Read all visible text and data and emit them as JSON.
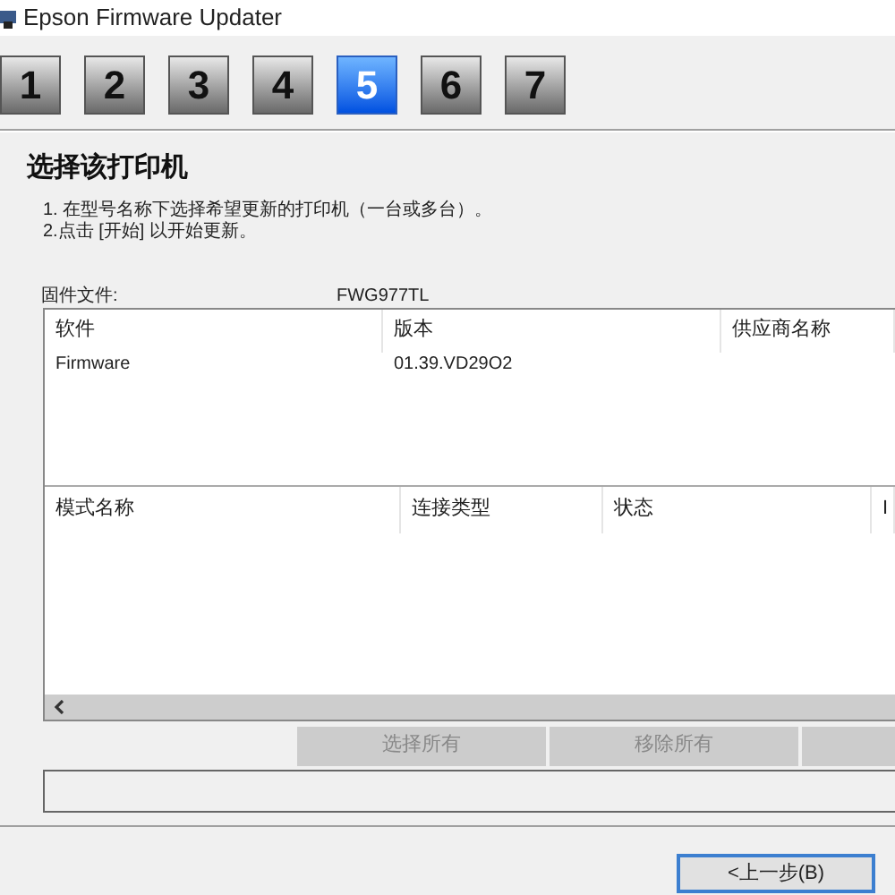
{
  "window": {
    "title": "Epson Firmware Updater"
  },
  "steps": [
    {
      "label": "1",
      "selected": false
    },
    {
      "label": "2",
      "selected": false
    },
    {
      "label": "3",
      "selected": false
    },
    {
      "label": "4",
      "selected": false
    },
    {
      "label": "5",
      "selected": true
    },
    {
      "label": "6",
      "selected": false
    },
    {
      "label": "7",
      "selected": false
    }
  ],
  "heading": "选择该打印机",
  "instructions": [
    "1. 在型号名称下选择希望更新的打印机（一台或多台）。",
    "2.点击 [开始] 以开始更新。"
  ],
  "firmware_file": {
    "label": "固件文件:",
    "value": "FWG977TL"
  },
  "software_table": {
    "columns": [
      "软件",
      "版本",
      "供应商名称"
    ],
    "rows": [
      [
        "Firmware",
        "01.39.VD29O2",
        ""
      ]
    ]
  },
  "printer_table": {
    "columns": [
      "模式名称",
      "连接类型",
      "状态",
      "I"
    ]
  },
  "buttons": [
    {
      "label": "选择所有",
      "disabled": true
    },
    {
      "label": "移除所有",
      "disabled": true
    },
    {
      "disabled": true
    }
  ],
  "back_button": "<上一步(B)"
}
